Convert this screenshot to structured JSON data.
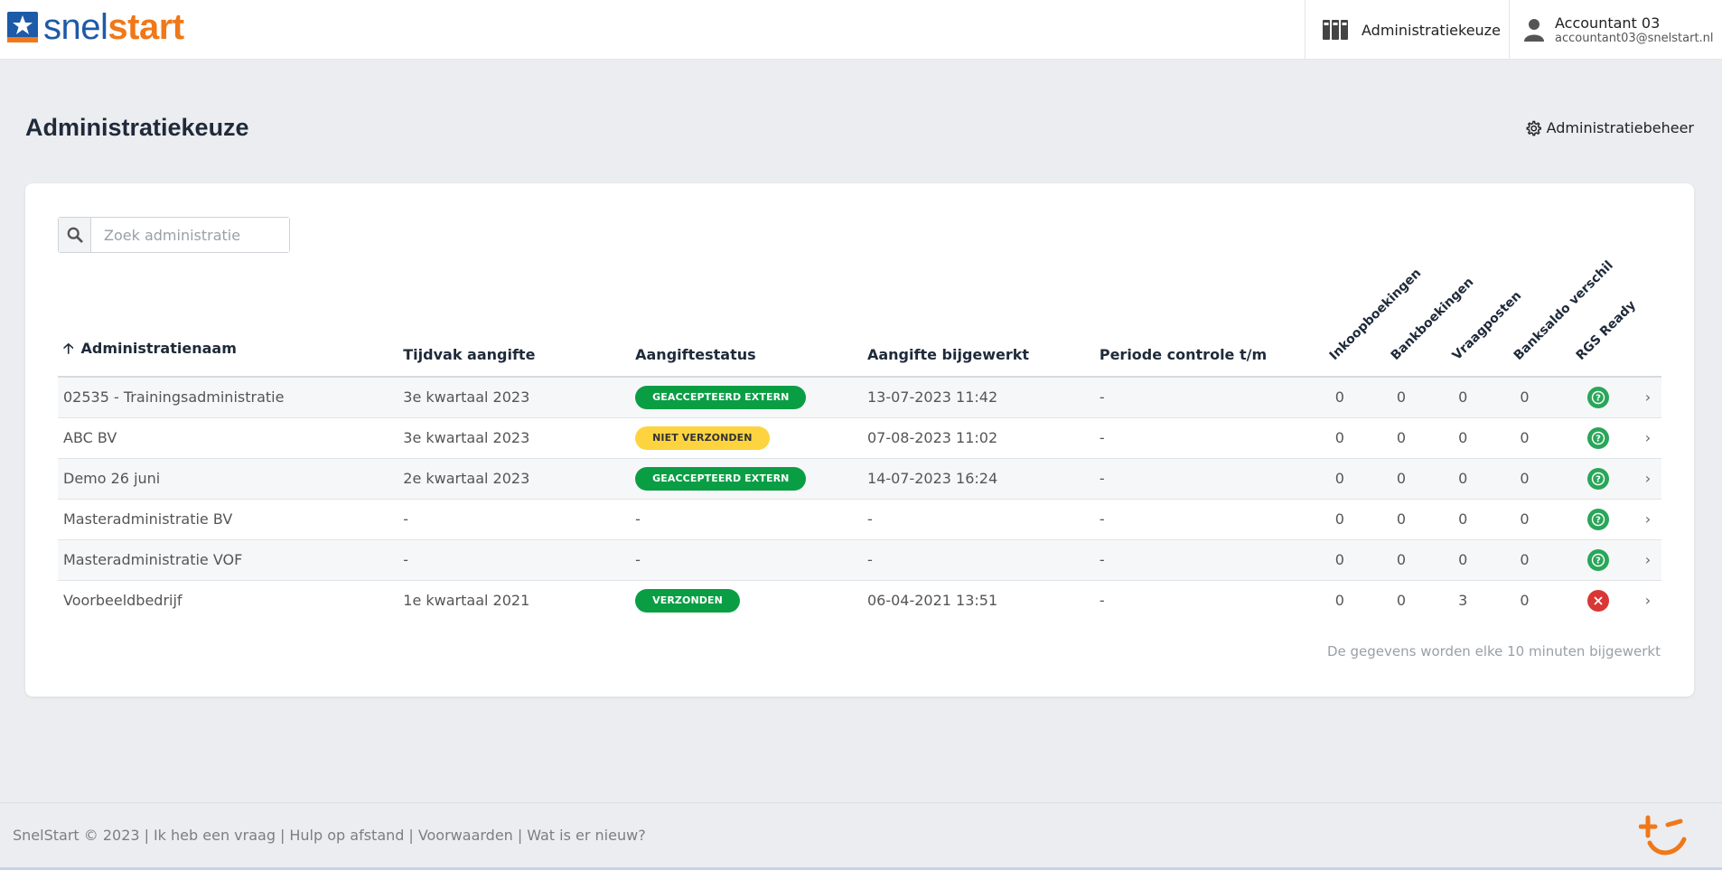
{
  "brand": {
    "part1": "snel",
    "part2": "start",
    "accent": "#f07818",
    "primary": "#1d5aa8"
  },
  "header": {
    "admin_link": "Administratiekeuze",
    "user_name": "Accountant 03",
    "user_email": "accountant03@snelstart.nl"
  },
  "page": {
    "title": "Administratiekeuze",
    "manage_link": "Administratiebeheer"
  },
  "search": {
    "placeholder": "Zoek administratie"
  },
  "table": {
    "columns": {
      "name": "Administratienaam",
      "period": "Tijdvak aangifte",
      "status": "Aangiftestatus",
      "updated": "Aangifte bijgewerkt",
      "control": "Periode controle t/m",
      "inkoop": "Inkoopboekingen",
      "bank": "Bankboekingen",
      "vraag": "Vraagposten",
      "saldo": "Banksaldo verschil",
      "rgs": "RGS Ready"
    },
    "rows": [
      {
        "name": "02535 - Trainingsadministratie",
        "period": "3e kwartaal 2023",
        "status": "GEACCEPTEERD EXTERN",
        "updated": "13-07-2023 11:42",
        "control": "-",
        "inkoop": "0",
        "bank": "0",
        "vraag": "0",
        "saldo": "0"
      },
      {
        "name": "ABC BV",
        "period": "3e kwartaal 2023",
        "status": "NIET VERZONDEN",
        "updated": "07-08-2023 11:02",
        "control": "-",
        "inkoop": "0",
        "bank": "0",
        "vraag": "0",
        "saldo": "0"
      },
      {
        "name": "Demo 26 juni",
        "period": "2e kwartaal 2023",
        "status": "GEACCEPTEERD EXTERN",
        "updated": "14-07-2023 16:24",
        "control": "-",
        "inkoop": "0",
        "bank": "0",
        "vraag": "0",
        "saldo": "0"
      },
      {
        "name": "Masteradministratie BV",
        "period": "-",
        "status": "-",
        "updated": "-",
        "control": "-",
        "inkoop": "0",
        "bank": "0",
        "vraag": "0",
        "saldo": "0"
      },
      {
        "name": "Masteradministratie VOF",
        "period": "-",
        "status": "-",
        "updated": "-",
        "control": "-",
        "inkoop": "0",
        "bank": "0",
        "vraag": "0",
        "saldo": "0"
      },
      {
        "name": "Voorbeeldbedrijf",
        "period": "1e kwartaal 2021",
        "status": "VERZONDEN",
        "updated": "06-04-2021 13:51",
        "control": "-",
        "inkoop": "0",
        "bank": "0",
        "vraag": "3",
        "saldo": "0"
      }
    ]
  },
  "update_note": "De gegevens worden elke 10 minuten bijgewerkt",
  "footer": {
    "copyright": "SnelStart © 2023",
    "links": [
      "Ik heb een vraag",
      "Hulp op afstand",
      "Voorwaarden",
      "Wat is er nieuw?"
    ]
  }
}
